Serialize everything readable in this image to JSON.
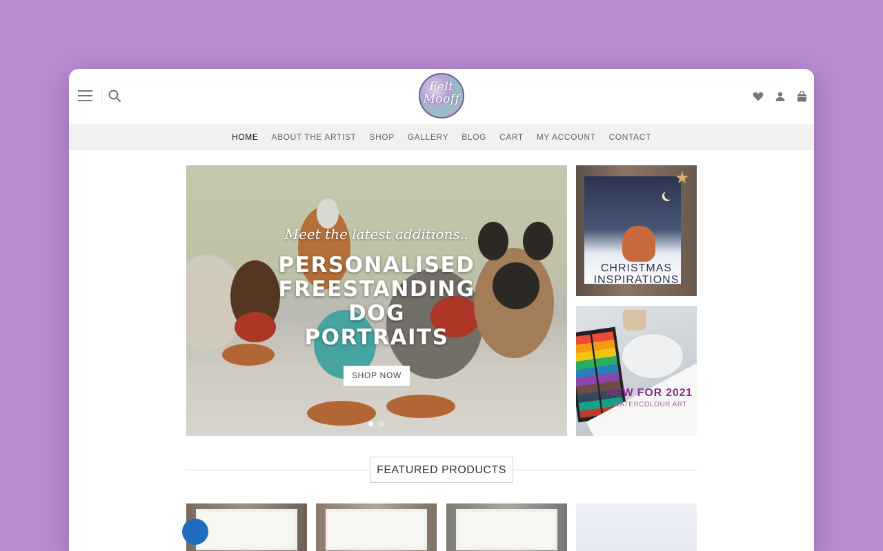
{
  "header": {
    "logo_text": "Felt Mooff",
    "icons": [
      "menu-icon",
      "search-icon",
      "heart-icon",
      "user-icon",
      "bag-icon"
    ]
  },
  "nav": {
    "items": [
      "HOME",
      "ABOUT THE ARTIST",
      "SHOP",
      "GALLERY",
      "BLOG",
      "CART",
      "MY ACCOUNT",
      "CONTACT"
    ],
    "active": "HOME"
  },
  "hero": {
    "caption": "Meet the latest additions..",
    "title": "PERSONALISED FREESTANDING DOG PORTRAITS",
    "button": "SHOP NOW",
    "slide_count": 2,
    "active_slide": 1
  },
  "banners": {
    "christmas": "CHRISTMAS INSPIRATIONS",
    "new_title": "NEW FOR 2021",
    "new_subtitle": "WATERCOLOUR ART"
  },
  "featured": {
    "title": "FEATURED PRODUCTS"
  },
  "colors": {
    "page_background": "#b88ccf",
    "nav_background": "#f1f1f1",
    "banner_purple": "#8e2a8f",
    "sale_badge": "#1e6bbf"
  }
}
